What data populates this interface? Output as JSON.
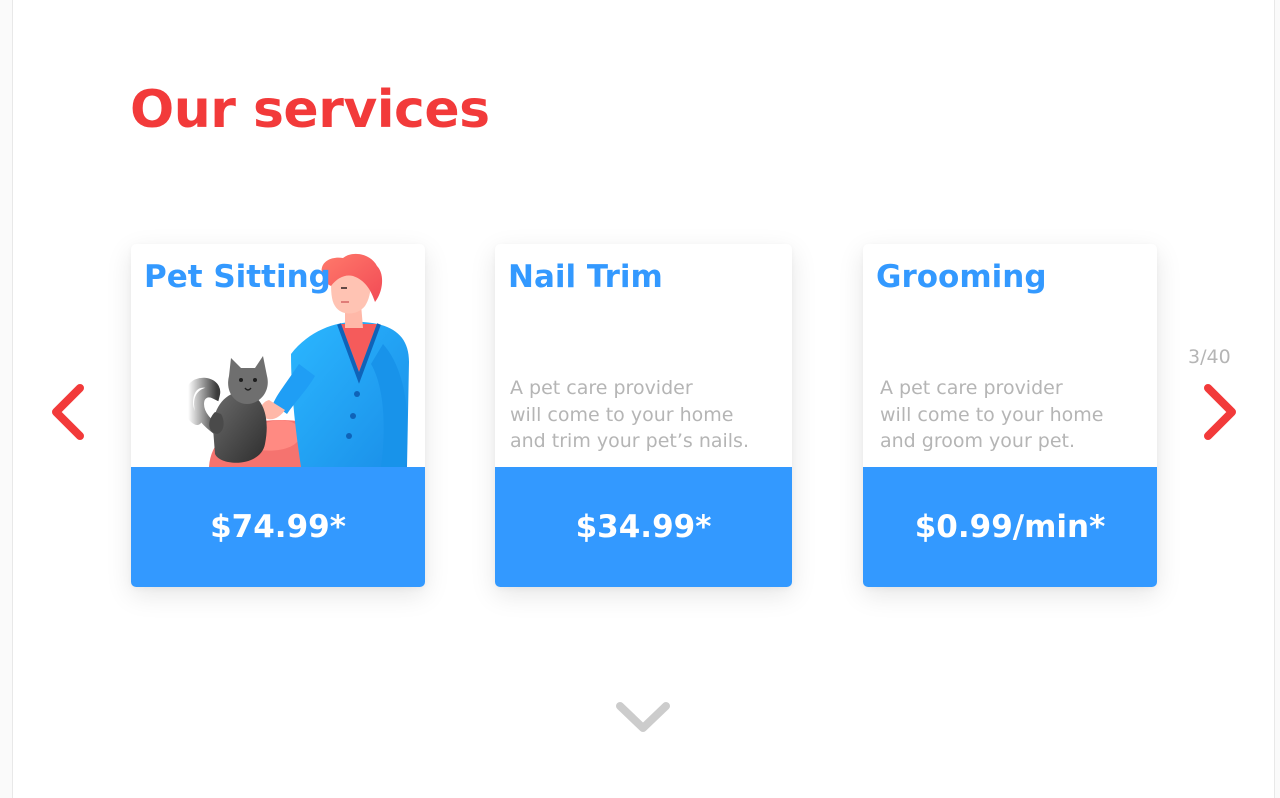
{
  "page": {
    "title": "Our services"
  },
  "services": [
    {
      "title": "Pet Sitting",
      "description": [],
      "price": "$74.99*",
      "illustration": "person-with-cat-illustration"
    },
    {
      "title": "Nail Trim",
      "description": [
        "A pet care provider",
        "will come to your home",
        "and trim your pet’s nails."
      ],
      "price": "$34.99*"
    },
    {
      "title": "Grooming",
      "description": [
        "A pet care provider",
        "will come to your home",
        "and groom your pet."
      ],
      "price": "$0.99/min*"
    }
  ],
  "pager": {
    "text": "3/40"
  },
  "icons": {
    "prev": "chevron-left-icon",
    "next": "chevron-right-icon",
    "scroll_down": "chevron-down-icon"
  },
  "colors": {
    "heading": "#f23a3a",
    "accent_blue": "#3399ff",
    "muted_text": "#b5b5b5",
    "arrow_red": "#f23a3a",
    "chevron_gray": "#cccccc"
  }
}
